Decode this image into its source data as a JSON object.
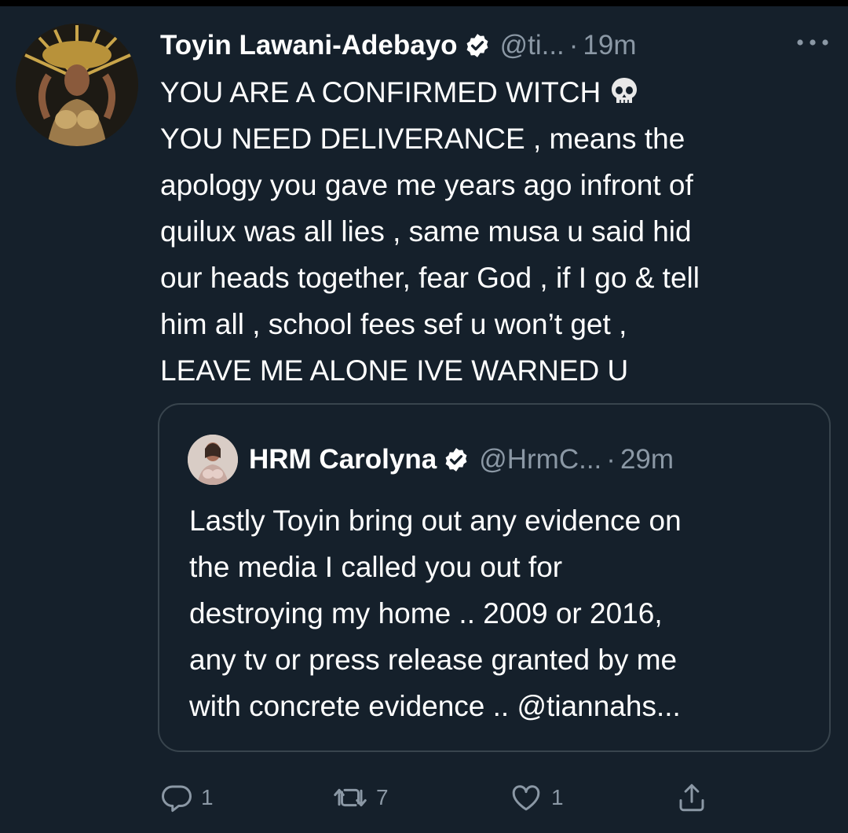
{
  "tweet": {
    "author_name": "Toyin Lawani-Adebayo",
    "handle": "@ti...",
    "separator": "·",
    "time": "19m",
    "verified_icon": "verified-badge-icon",
    "more_icon": "more-icon",
    "lines": [
      "YOU ARE A CONFIRMED WITCH",
      "YOU NEED DELIVERANCE , means the",
      "apology you gave me years ago infront of",
      "quilux was all lies , same musa u said hid",
      "our heads together, fear God , if I go & tell",
      "him all , school fees sef u won’t get ,",
      "LEAVE ME ALONE IVE WARNED U"
    ],
    "emoji": "skull-emoji"
  },
  "quoted_tweet": {
    "author_name": "HRM Carolyna",
    "handle": "@HrmC...",
    "separator": "·",
    "time": "29m",
    "lines": [
      "Lastly Toyin bring out any evidence on",
      "the media I called you out for",
      "destroying my home .. 2009 or 2016,",
      "any tv or press release granted by me",
      "with concrete evidence .. @tiannahs..."
    ]
  },
  "actions": {
    "reply_count": "1",
    "retweet_count": "7",
    "like_count": "1"
  },
  "colors": {
    "background": "#15202b",
    "text": "#ffffff",
    "secondary": "#8b98a5",
    "border": "#38444d"
  }
}
